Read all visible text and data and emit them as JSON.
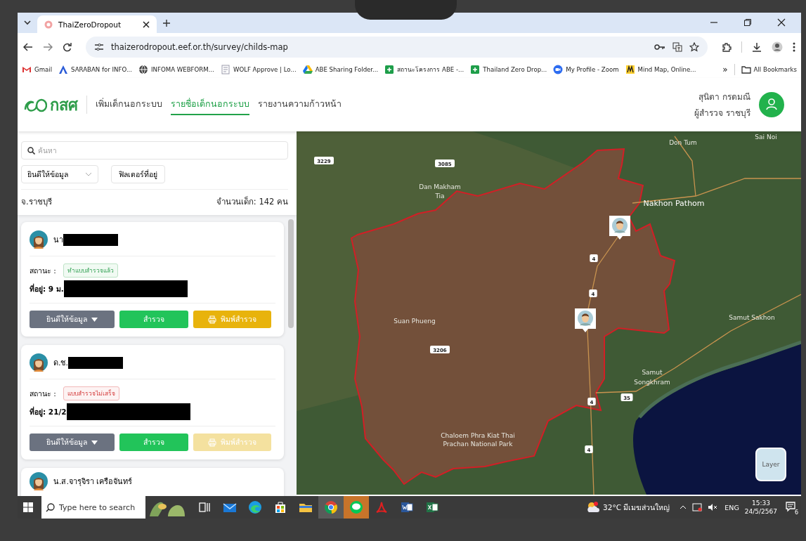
{
  "browser": {
    "tabs": [
      {
        "title": "ThaiZeroDropout",
        "selected": true
      }
    ],
    "url": "thaizerodropout.eef.or.th/survey/childs-map",
    "bookmarks": [
      {
        "kind": "gmail",
        "label": "Gmail"
      },
      {
        "kind": "triangle",
        "label": "SARABAN for INFO..."
      },
      {
        "kind": "globe",
        "label": "INFOMA WEBFORM..."
      },
      {
        "kind": "page",
        "label": "WOLF Approve | Lo..."
      },
      {
        "kind": "drive",
        "label": "ABE Sharing Folder..."
      },
      {
        "kind": "sheet",
        "label": "สถานะโครงการ ABE -..."
      },
      {
        "kind": "sheet",
        "label": "Thailand Zero Drop..."
      },
      {
        "kind": "zoom",
        "label": "My Profile - Zoom"
      },
      {
        "kind": "mindmap",
        "label": "Mind Map, Online..."
      }
    ],
    "more": "»",
    "all_bookmarks": "All Bookmarks"
  },
  "header": {
    "logo_text": "กสศ",
    "nav": [
      {
        "label": "เพิ่มเด็กนอกระบบ",
        "selected": false
      },
      {
        "label": "รายชื่อเด็กนอกระบบ",
        "selected": true
      },
      {
        "label": "รายงานความก้าวหน้า",
        "selected": false
      }
    ],
    "user_name": "สุนิตา กรดมณี",
    "user_role": "ผู้สำรวจ ราชบุรี"
  },
  "sidebar": {
    "search_placeholder": "ค้นหา",
    "consent_filter": "ยินดีให้ข้อมูล",
    "address_filter": "ฟิลเตอร์ที่อยู่",
    "province": "จ.ราชบุรี",
    "count": "จำนวนเด็ก: 142 คน",
    "cards": [
      {
        "name": "นา",
        "status_label": "สถานะ :",
        "status": {
          "text": "ทำแบบสำรวจแล้ว",
          "kind": "done"
        },
        "address": "ที่อยู่: 9 ม.",
        "buttons": [
          {
            "kind": "dropdown",
            "label": "ยินดีให้ข้อมูล",
            "disabled": false
          },
          {
            "kind": "survey",
            "label": "สำรวจ",
            "disabled": false
          },
          {
            "kind": "print",
            "label": "พิมพ์สำรวจ",
            "disabled": false
          }
        ]
      },
      {
        "name": "ด.ช.",
        "status_label": "สถานะ :",
        "status": {
          "text": "แบบสำรวจไม่เสร็จ",
          "kind": "incomplete"
        },
        "address": "ที่อยู่: 21/2",
        "buttons": [
          {
            "kind": "dropdown",
            "label": "ยินดีให้ข้อมูล",
            "disabled": false
          },
          {
            "kind": "survey",
            "label": "สำรวจ",
            "disabled": false
          },
          {
            "kind": "print",
            "label": "พิมพ์สำรวจ",
            "disabled": true
          }
        ]
      },
      {
        "name": "น.ส.จารุจิรา เครือจันทร์"
      }
    ]
  },
  "map": {
    "labels": [
      {
        "kind": "shield",
        "text": "3229"
      },
      {
        "kind": "shield",
        "text": "3085"
      },
      {
        "kind": "place",
        "text": "Dan Makham"
      },
      {
        "kind": "place",
        "text": "Tia"
      },
      {
        "kind": "place",
        "text": "Don Tum"
      },
      {
        "kind": "place",
        "text": "Sai Noi"
      },
      {
        "kind": "city",
        "text": "Nakhon Pathom"
      },
      {
        "kind": "place",
        "text": "Samut Sakhon"
      },
      {
        "kind": "place",
        "text": "Suan Phueng"
      },
      {
        "kind": "shield",
        "text": "3206"
      },
      {
        "kind": "place",
        "text": "Samut"
      },
      {
        "kind": "place",
        "text": "Songkhram"
      },
      {
        "kind": "shield",
        "text": "35"
      },
      {
        "kind": "shield",
        "text": "4"
      },
      {
        "kind": "shield",
        "text": "4"
      },
      {
        "kind": "shield",
        "text": "4"
      },
      {
        "kind": "shield",
        "text": "4"
      },
      {
        "kind": "place",
        "text": "Chaloem Phra Kiat Thai"
      },
      {
        "kind": "place",
        "text": "Prachan National Park"
      }
    ],
    "layer_button": "Layer"
  },
  "taskbar": {
    "search_placeholder": "Type here to search",
    "apps": [
      {
        "kind": "taskview",
        "active": false,
        "flashing": false
      },
      {
        "kind": "mail",
        "active": false,
        "flashing": false
      },
      {
        "kind": "edge",
        "active": false,
        "flashing": false
      },
      {
        "kind": "store",
        "active": false,
        "flashing": false
      },
      {
        "kind": "folder",
        "active": false,
        "flashing": false
      },
      {
        "kind": "chrome",
        "active": true,
        "flashing": false
      },
      {
        "kind": "chat",
        "active": false,
        "flashing": true
      },
      {
        "kind": "pdf",
        "active": false,
        "flashing": false
      },
      {
        "kind": "word",
        "active": false,
        "flashing": false
      },
      {
        "kind": "excel",
        "active": false,
        "flashing": false
      }
    ],
    "weather": "32°C มีเมฆส่วนใหญ่",
    "language": "ENG",
    "time": "15:33",
    "date": "24/5/2567",
    "notifications": "6"
  }
}
